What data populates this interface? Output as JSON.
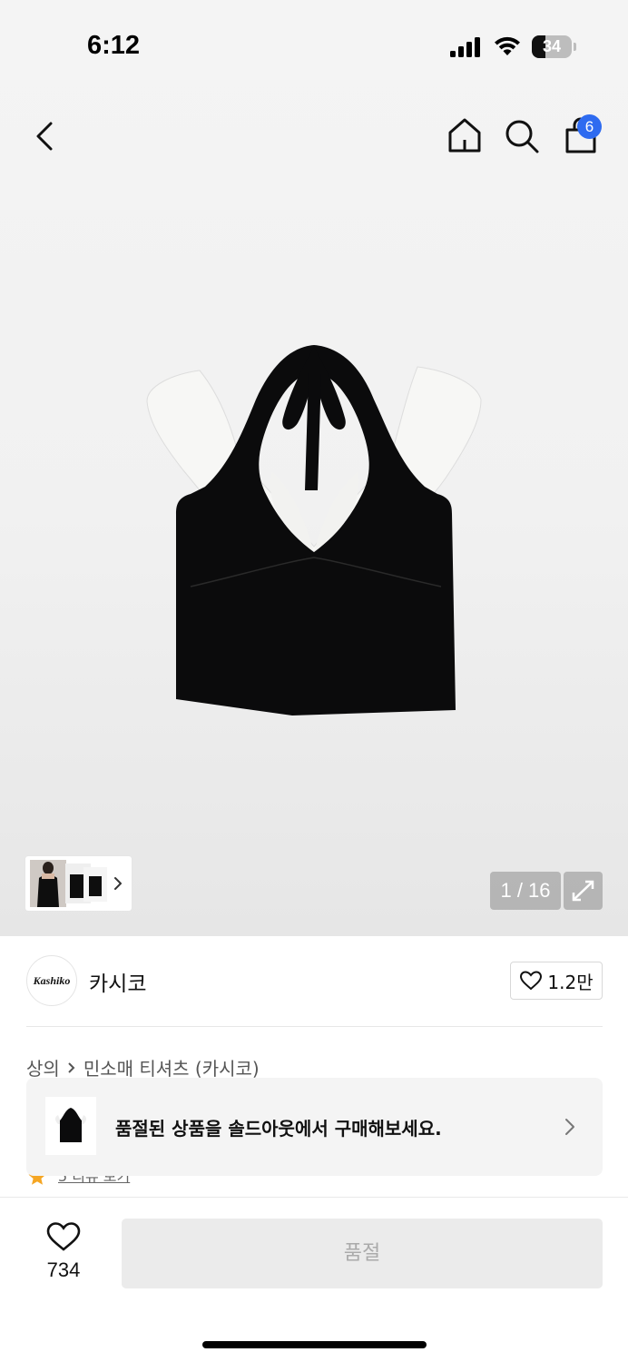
{
  "status_bar": {
    "time": "6:12",
    "battery_percent": "34",
    "battery_level": 0.34
  },
  "nav": {
    "back_icon": "chevron-left-icon",
    "home_icon": "home-icon",
    "search_icon": "search-icon",
    "bag_icon": "shopping-bag-icon",
    "cart_count": "6",
    "badge_color": "#2e6bf0"
  },
  "gallery": {
    "current": "1",
    "total": "16",
    "counter": "1 / 16"
  },
  "brand": {
    "logo_text": "Kashiko",
    "name": "카시코",
    "likes": "1.2만"
  },
  "breadcrumb": {
    "category": "상의",
    "subcategory": "민소매 티셔츠 (카시코)"
  },
  "soldout_banner": {
    "text": "품절된 상품을 솔드아웃에서 구매해보세요."
  },
  "partial_row": {
    "text": "5 리뷰 보기"
  },
  "bottom_bar": {
    "like_count": "734",
    "action_label": "품절"
  }
}
